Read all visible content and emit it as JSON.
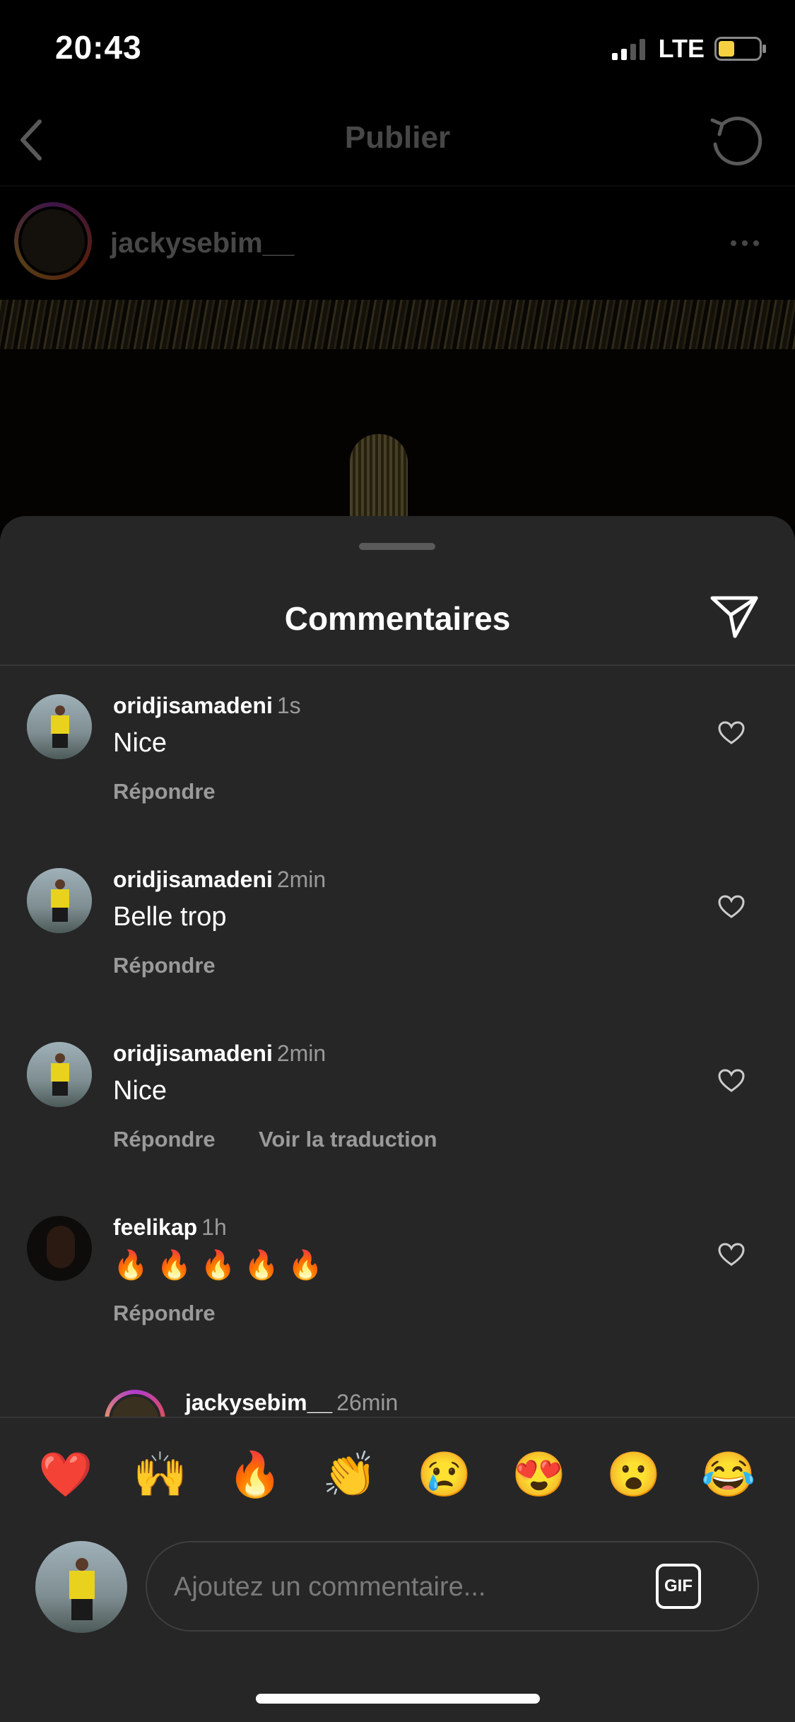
{
  "status_bar": {
    "time": "20:43",
    "network": "LTE"
  },
  "nav": {
    "title": "Publier"
  },
  "post": {
    "username": "jackysebim__"
  },
  "sheet": {
    "title": "Commentaires"
  },
  "comments": [
    {
      "username": "oridjisamadeni",
      "time": "1s",
      "text": "Nice",
      "reply": "Répondre"
    },
    {
      "username": "oridjisamadeni",
      "time": "2min",
      "text": "Belle trop",
      "reply": "Répondre"
    },
    {
      "username": "oridjisamadeni",
      "time": "2min",
      "text": "Nice",
      "reply": "Répondre",
      "translate": "Voir la traduction"
    },
    {
      "username": "feelikap",
      "time": "1h",
      "text": "🔥🔥🔥🔥🔥",
      "reply": "Répondre"
    },
    {
      "username": "jackysebim__",
      "time": "26min"
    }
  ],
  "reactions": [
    "❤️",
    "🙌",
    "🔥",
    "👏",
    "😢",
    "😍",
    "😮",
    "😂"
  ],
  "composer": {
    "placeholder": "Ajoutez un commentaire...",
    "gif_label": "GIF"
  },
  "colors": {
    "sheet_bg": "#262626",
    "muted_text": "#9a9a9a",
    "accent_gradient_start": "#b03bd1",
    "accent_gradient_end": "#f5b341"
  }
}
